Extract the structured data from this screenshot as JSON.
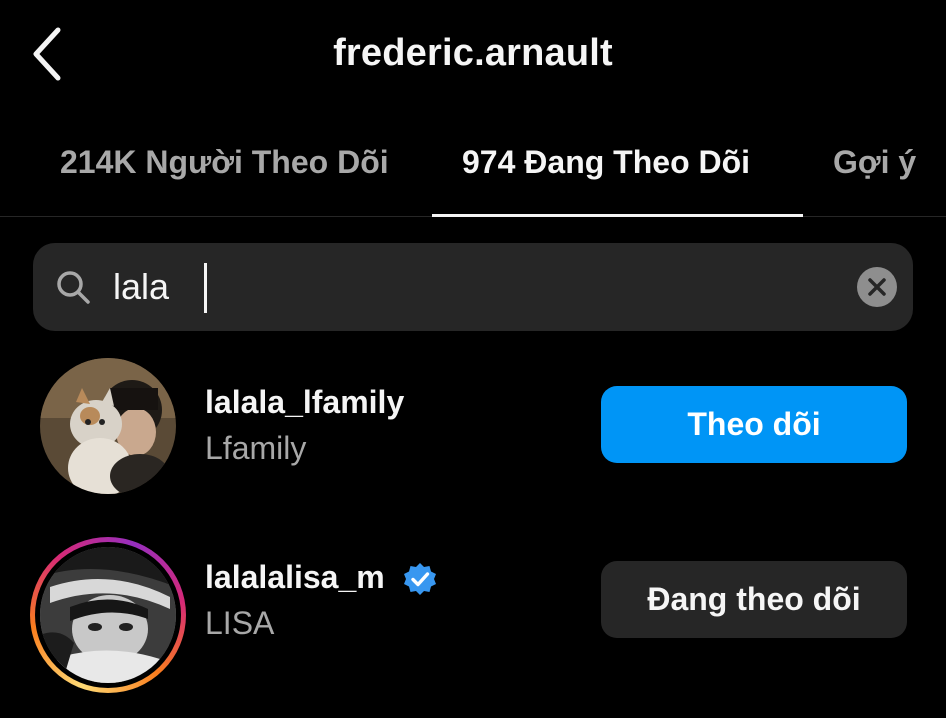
{
  "header": {
    "title": "frederic.arnault",
    "back_icon": "chevron-left-icon"
  },
  "tabs": [
    {
      "label": "214K Người Theo Dõi",
      "active": false
    },
    {
      "label": "974 Đang Theo Dõi",
      "active": true
    },
    {
      "label": "Gợi ý",
      "active": false
    }
  ],
  "search": {
    "value": "lala",
    "search_icon": "search-icon",
    "clear_icon": "clear-icon"
  },
  "users": [
    {
      "username": "lalala_lfamily",
      "full_name": "Lfamily",
      "verified": false,
      "has_story_ring": false,
      "button_label": "Theo dõi",
      "button_style": "follow"
    },
    {
      "username": "lalalalisa_m",
      "full_name": "LISA",
      "verified": true,
      "has_story_ring": true,
      "button_label": "Đang theo dõi",
      "button_style": "following"
    }
  ],
  "colors": {
    "background": "#000000",
    "primary_text": "#f5f5f5",
    "secondary_text": "#a8a8a8",
    "follow_button": "#0095f6",
    "following_button": "#262626",
    "search_background": "#262626",
    "verified_badge": "#3897f0"
  }
}
